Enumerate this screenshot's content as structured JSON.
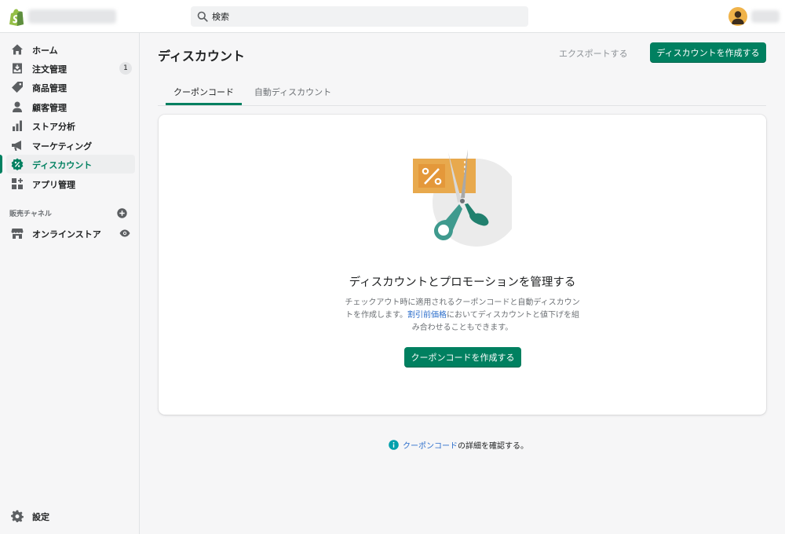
{
  "colors": {
    "accent": "#008060",
    "link": "#2c6ecb"
  },
  "header": {
    "search_placeholder": "検索"
  },
  "sidebar": {
    "items": [
      {
        "label": "ホーム",
        "icon": "home-icon"
      },
      {
        "label": "注文管理",
        "icon": "orders-icon",
        "badge": "1"
      },
      {
        "label": "商品管理",
        "icon": "tag-icon"
      },
      {
        "label": "顧客管理",
        "icon": "person-icon"
      },
      {
        "label": "ストア分析",
        "icon": "bar-chart-icon"
      },
      {
        "label": "マーケティング",
        "icon": "megaphone-icon"
      },
      {
        "label": "ディスカウント",
        "icon": "discount-icon",
        "active": true
      },
      {
        "label": "アプリ管理",
        "icon": "apps-icon"
      }
    ],
    "channels_heading": "販売チャネル",
    "channel_online_store": "オンラインストア",
    "settings_label": "設定"
  },
  "page": {
    "title": "ディスカウント",
    "export_label": "エクスポートする",
    "create_label": "ディスカウントを作成する",
    "tabs": [
      "クーポンコード",
      "自動ディスカウント"
    ]
  },
  "empty_state": {
    "heading": "ディスカウントとプロモーションを管理する",
    "body_before_link": "チェックアウト時に適用されるクーポンコードと自動ディスカウントを作成します。",
    "body_link": "割引前価格",
    "body_after_link": "においてディスカウントと値下げを組み合わせることもできます。",
    "button_label": "クーポンコードを作成する"
  },
  "footer": {
    "link": "クーポンコード",
    "text": "の詳細を確認する。"
  }
}
